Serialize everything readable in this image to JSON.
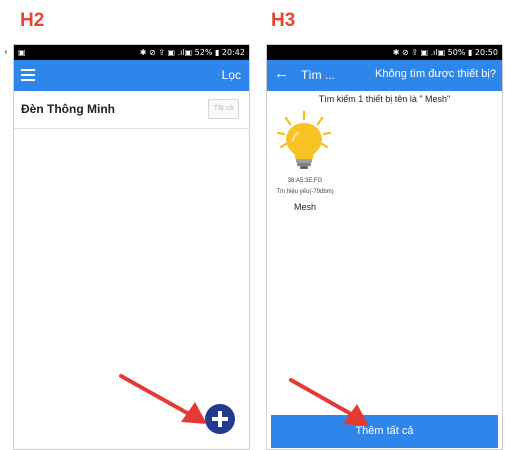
{
  "headings": {
    "left": "H2",
    "right": "H3"
  },
  "stray_mark": ",",
  "screen_h2": {
    "status": {
      "system_icons": "▣",
      "right": "✱ ⊘ ⇪ ▣ .ıl▣ 52% ▮ 20:42"
    },
    "appbar": {
      "menu_icon": "hamburger-icon",
      "filter_label": "Lọc"
    },
    "devices": [
      {
        "name": "Đèn Thông Minh",
        "toggle_label": "Tắt cả"
      }
    ],
    "fab_icon": "plus-icon"
  },
  "screen_h3": {
    "status": {
      "right": "✱ ⊘ ⇪ ▣ .ıl▣ 50% ▮ 20:50"
    },
    "appbar": {
      "back_icon": "←",
      "title": "Tìm ...",
      "link": "Không tìm được thiết bị?"
    },
    "search_result": "Tìm kiếm 1 thiết bị tên là \" Mesh\"",
    "device": {
      "icon": "lightbulb-icon",
      "mac": "38:A5:3E:FG",
      "signal": "Tín hiệu yếu(-79dbm)",
      "name": "Mesh"
    },
    "add_all_label": "Thêm tất cả"
  },
  "colors": {
    "accent": "#2e86ea",
    "heading": "#e8452f",
    "arrow": "#e53935",
    "fab": "#233a8f",
    "bulb": "#f7c324"
  }
}
